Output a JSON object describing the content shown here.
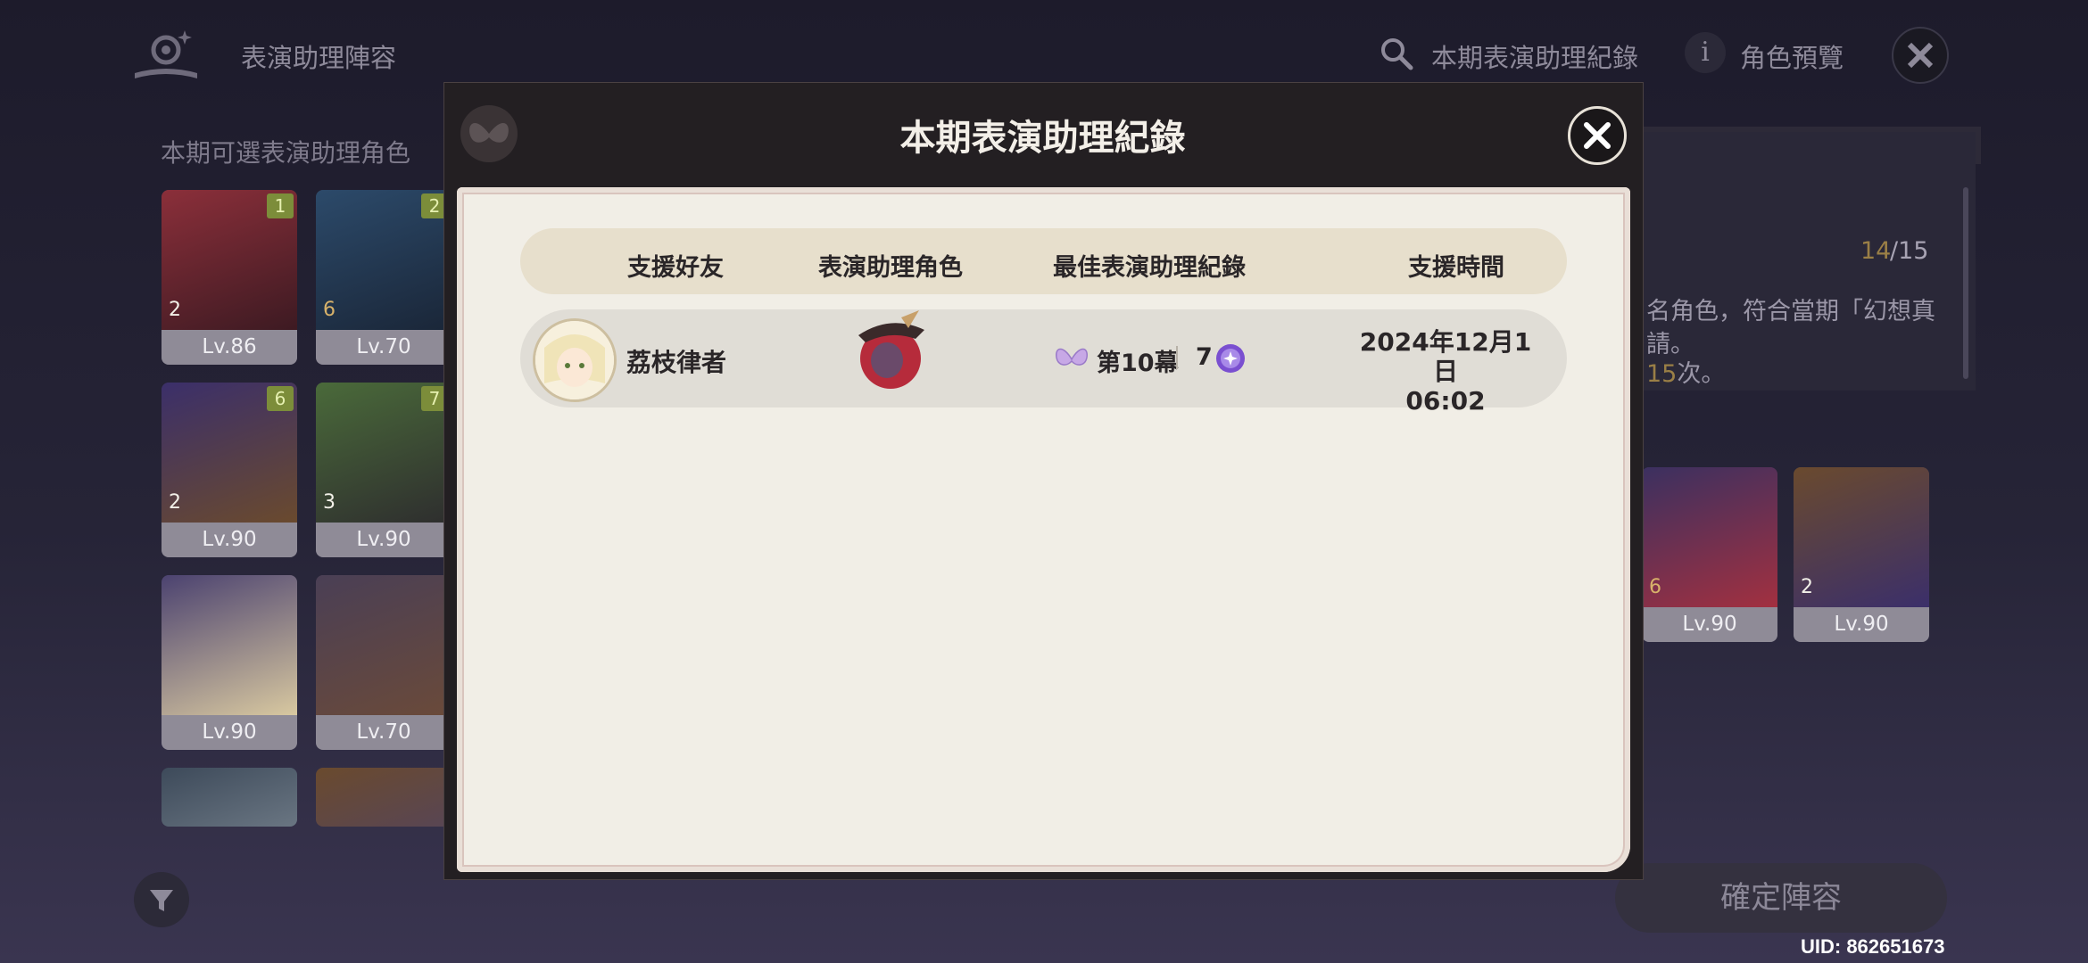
{
  "background": {
    "header": {
      "title": "表演助理陣容",
      "search_label": "本期表演助理紀錄",
      "info_icon_glyph": "i",
      "preview_label": "角色預覽"
    },
    "section_label": "本期可選表演助理角色",
    "cards": [
      {
        "level": "Lv.86",
        "badge": "1",
        "cons": "2",
        "colors": [
          "#8b2f3a",
          "#3d1a22"
        ]
      },
      {
        "level": "Lv.70",
        "badge": "2",
        "cons": "6",
        "colors": [
          "#2c4a6a",
          "#1a2638"
        ]
      },
      {
        "level": "Lv.90",
        "badge": "6",
        "cons": "2",
        "colors": [
          "#3b2f6a",
          "#6a4a2e"
        ]
      },
      {
        "level": "Lv.90",
        "badge": "7",
        "cons": "3",
        "colors": [
          "#4a6a3a",
          "#2e2e2e"
        ]
      },
      {
        "level": "Lv.90",
        "badge": "",
        "cons": "",
        "colors": [
          "#4b4270",
          "#d8c8a0"
        ]
      },
      {
        "level": "Lv.70",
        "badge": "",
        "cons": "",
        "colors": [
          "#4a3f55",
          "#6a4a3a"
        ]
      }
    ],
    "right_cards": [
      {
        "level": "Lv.90",
        "cons": "6",
        "colors": [
          "#3b3060",
          "#a23040"
        ]
      },
      {
        "level": "Lv.90",
        "cons": "2",
        "colors": [
          "#6a4a2e",
          "#3b2f6a"
        ]
      }
    ],
    "right_panel": {
      "count_current": "14",
      "count_max": "/15",
      "desc_line1": "名角色，符合當期「幻想真",
      "desc_line2": "請。",
      "desc_line3_hl": "15",
      "desc_line3_tail": "次。"
    },
    "confirm_button": "確定陣容",
    "uid": "UID: 862651673"
  },
  "modal": {
    "title": "本期表演助理紀錄",
    "columns": [
      "支援好友",
      "表演助理角色",
      "最佳表演助理紀錄",
      "支援時間"
    ],
    "rows": [
      {
        "friend_name": "荔枝律者",
        "best_act": "第10幕",
        "best_stars": "7",
        "time_date": "2024年12月1日",
        "time_clock": "06:02"
      }
    ]
  },
  "colors": {
    "accent_gold": "#9a7f46",
    "modal_bg": "#231f22",
    "paper": "#f1eee6",
    "level_badge": "#7c8d3a"
  },
  "icons": {
    "header_logo": "theater-logo-icon",
    "search": "search-icon",
    "info": "info-icon",
    "close": "close-icon",
    "filter": "filter-icon",
    "butterfly": "butterfly-icon",
    "star": "star-medal-icon"
  }
}
